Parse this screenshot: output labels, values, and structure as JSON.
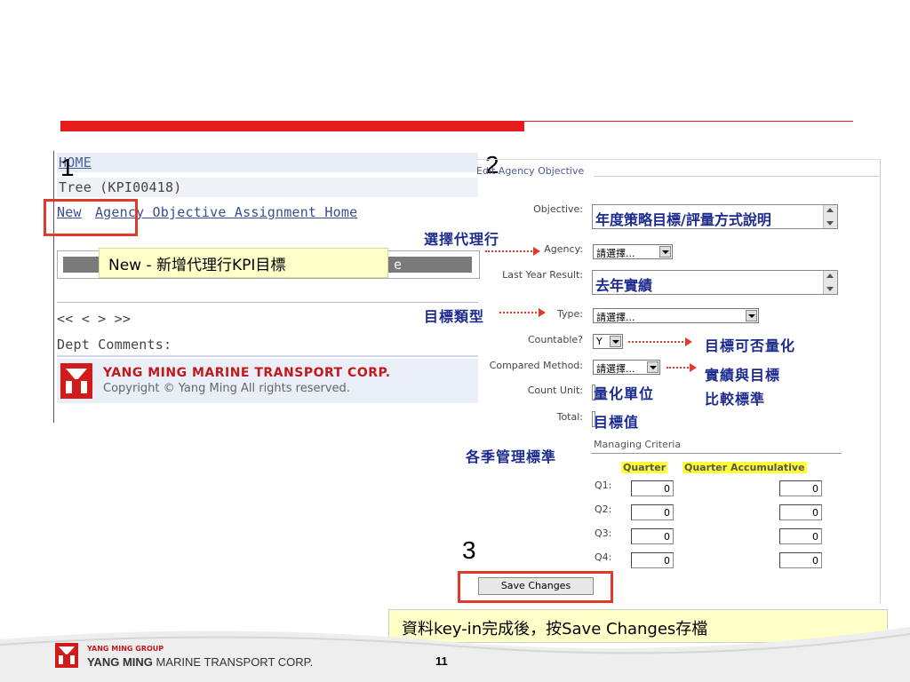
{
  "left_panel": {
    "home": "HOME",
    "tree": "Tree (KPI00418)",
    "new_link": "New",
    "assignment_link": "Agency Objective Assignment Home",
    "nav": "<< < > >>",
    "dept_comments": "Dept Comments:",
    "company_name": "YANG MING MARINE TRANSPORT CORP.",
    "copyright": "Copyright © Yang Ming All rights reserved.",
    "hidden_text": "e"
  },
  "annotations": {
    "step1": "1",
    "step2": "2",
    "step3": "3",
    "new_note": "New - 新增代理行KPI目標",
    "select_agency": "選擇代理行",
    "target_type": "目標類型",
    "countable_note": "目標可否量化",
    "compare_note_1": "實績與目標",
    "compare_note_2": "比較標準",
    "criteria_note": "各季管理標準",
    "save_note": "資料key-in完成後，按Save Changes存檔"
  },
  "form": {
    "title": "Edit Agency Objective",
    "objective_label": "Objective:",
    "objective_value": "年度策略目標/評量方式說明",
    "agency_label": "Agency:",
    "agency_value": "請選擇...",
    "last_year_label": "Last Year Result:",
    "last_year_value": "去年實績",
    "type_label": "Type:",
    "type_value": "請選擇...",
    "countable_label": "Countable?",
    "countable_value": "Y",
    "compared_label": "Compared Method:",
    "compared_value": "請選擇...",
    "count_unit_label": "Count Unit:",
    "count_unit_value": "量化單位",
    "total_label": "Total:",
    "total_value": "目標值",
    "managing_criteria": "Managing Criteria",
    "col_quarter": "Quarter",
    "col_accum": "Quarter Accumulative",
    "quarters": [
      {
        "label": "Q1:",
        "quarter": "0",
        "accum": "0"
      },
      {
        "label": "Q2:",
        "quarter": "0",
        "accum": "0"
      },
      {
        "label": "Q3:",
        "quarter": "0",
        "accum": "0"
      },
      {
        "label": "Q4:",
        "quarter": "0",
        "accum": "0"
      }
    ],
    "save_button": "Save Changes"
  },
  "footer": {
    "group": "YANG MING GROUP",
    "corp_bold": "YANG MING",
    "corp_rest": " MARINE TRANSPORT CORP.",
    "page": "11"
  },
  "colors": {
    "accent_red": "#e61b1b",
    "annotation_blue": "#1d2b8f",
    "note_yellow": "#ffffc8"
  }
}
